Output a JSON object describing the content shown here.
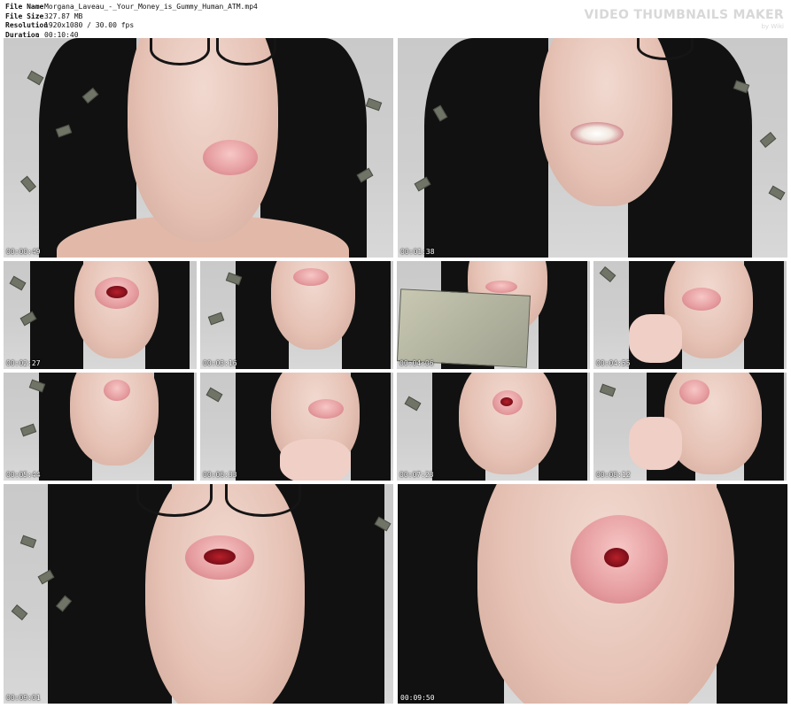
{
  "info": {
    "file_name_label": "File Name",
    "file_name": "Morgana_Laveau_-_Your_Money_is_Gummy_Human_ATM.mp4",
    "file_size_label": "File Size",
    "file_size": "327.87 MB",
    "resolution_label": "Resolution",
    "resolution": "1920x1080 / 30.00 fps",
    "duration_label": "Duration",
    "duration": "00:10:40",
    "separator": ":"
  },
  "brand": {
    "title": "VIDEO THUMBNAILS MAKER",
    "by": "by Wiki"
  },
  "thumbnails": [
    {
      "timestamp": "00:00:49"
    },
    {
      "timestamp": "00:01:38"
    },
    {
      "timestamp": "00:02:27"
    },
    {
      "timestamp": "00:03:16"
    },
    {
      "timestamp": "00:04:06"
    },
    {
      "timestamp": "00:04:55"
    },
    {
      "timestamp": "00:05:44"
    },
    {
      "timestamp": "00:06:33"
    },
    {
      "timestamp": "00:07:23"
    },
    {
      "timestamp": "00:08:12"
    },
    {
      "timestamp": "00:09:01"
    },
    {
      "timestamp": "00:09:50"
    }
  ]
}
